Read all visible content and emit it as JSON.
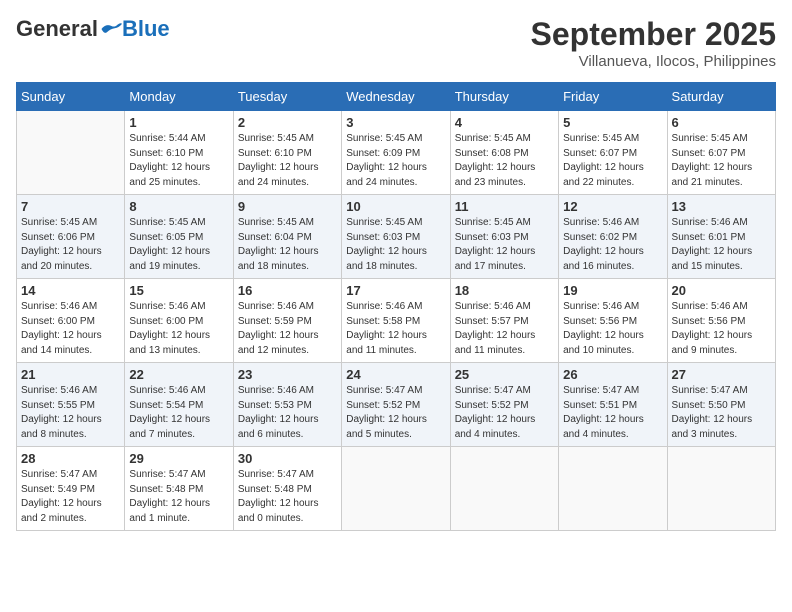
{
  "header": {
    "logo_general": "General",
    "logo_blue": "Blue",
    "month_title": "September 2025",
    "location": "Villanueva, Ilocos, Philippines"
  },
  "days_of_week": [
    "Sunday",
    "Monday",
    "Tuesday",
    "Wednesday",
    "Thursday",
    "Friday",
    "Saturday"
  ],
  "weeks": [
    [
      {
        "day": "",
        "info": ""
      },
      {
        "day": "1",
        "info": "Sunrise: 5:44 AM\nSunset: 6:10 PM\nDaylight: 12 hours\nand 25 minutes."
      },
      {
        "day": "2",
        "info": "Sunrise: 5:45 AM\nSunset: 6:10 PM\nDaylight: 12 hours\nand 24 minutes."
      },
      {
        "day": "3",
        "info": "Sunrise: 5:45 AM\nSunset: 6:09 PM\nDaylight: 12 hours\nand 24 minutes."
      },
      {
        "day": "4",
        "info": "Sunrise: 5:45 AM\nSunset: 6:08 PM\nDaylight: 12 hours\nand 23 minutes."
      },
      {
        "day": "5",
        "info": "Sunrise: 5:45 AM\nSunset: 6:07 PM\nDaylight: 12 hours\nand 22 minutes."
      },
      {
        "day": "6",
        "info": "Sunrise: 5:45 AM\nSunset: 6:07 PM\nDaylight: 12 hours\nand 21 minutes."
      }
    ],
    [
      {
        "day": "7",
        "info": "Sunrise: 5:45 AM\nSunset: 6:06 PM\nDaylight: 12 hours\nand 20 minutes."
      },
      {
        "day": "8",
        "info": "Sunrise: 5:45 AM\nSunset: 6:05 PM\nDaylight: 12 hours\nand 19 minutes."
      },
      {
        "day": "9",
        "info": "Sunrise: 5:45 AM\nSunset: 6:04 PM\nDaylight: 12 hours\nand 18 minutes."
      },
      {
        "day": "10",
        "info": "Sunrise: 5:45 AM\nSunset: 6:03 PM\nDaylight: 12 hours\nand 18 minutes."
      },
      {
        "day": "11",
        "info": "Sunrise: 5:45 AM\nSunset: 6:03 PM\nDaylight: 12 hours\nand 17 minutes."
      },
      {
        "day": "12",
        "info": "Sunrise: 5:46 AM\nSunset: 6:02 PM\nDaylight: 12 hours\nand 16 minutes."
      },
      {
        "day": "13",
        "info": "Sunrise: 5:46 AM\nSunset: 6:01 PM\nDaylight: 12 hours\nand 15 minutes."
      }
    ],
    [
      {
        "day": "14",
        "info": "Sunrise: 5:46 AM\nSunset: 6:00 PM\nDaylight: 12 hours\nand 14 minutes."
      },
      {
        "day": "15",
        "info": "Sunrise: 5:46 AM\nSunset: 6:00 PM\nDaylight: 12 hours\nand 13 minutes."
      },
      {
        "day": "16",
        "info": "Sunrise: 5:46 AM\nSunset: 5:59 PM\nDaylight: 12 hours\nand 12 minutes."
      },
      {
        "day": "17",
        "info": "Sunrise: 5:46 AM\nSunset: 5:58 PM\nDaylight: 12 hours\nand 11 minutes."
      },
      {
        "day": "18",
        "info": "Sunrise: 5:46 AM\nSunset: 5:57 PM\nDaylight: 12 hours\nand 11 minutes."
      },
      {
        "day": "19",
        "info": "Sunrise: 5:46 AM\nSunset: 5:56 PM\nDaylight: 12 hours\nand 10 minutes."
      },
      {
        "day": "20",
        "info": "Sunrise: 5:46 AM\nSunset: 5:56 PM\nDaylight: 12 hours\nand 9 minutes."
      }
    ],
    [
      {
        "day": "21",
        "info": "Sunrise: 5:46 AM\nSunset: 5:55 PM\nDaylight: 12 hours\nand 8 minutes."
      },
      {
        "day": "22",
        "info": "Sunrise: 5:46 AM\nSunset: 5:54 PM\nDaylight: 12 hours\nand 7 minutes."
      },
      {
        "day": "23",
        "info": "Sunrise: 5:46 AM\nSunset: 5:53 PM\nDaylight: 12 hours\nand 6 minutes."
      },
      {
        "day": "24",
        "info": "Sunrise: 5:47 AM\nSunset: 5:52 PM\nDaylight: 12 hours\nand 5 minutes."
      },
      {
        "day": "25",
        "info": "Sunrise: 5:47 AM\nSunset: 5:52 PM\nDaylight: 12 hours\nand 4 minutes."
      },
      {
        "day": "26",
        "info": "Sunrise: 5:47 AM\nSunset: 5:51 PM\nDaylight: 12 hours\nand 4 minutes."
      },
      {
        "day": "27",
        "info": "Sunrise: 5:47 AM\nSunset: 5:50 PM\nDaylight: 12 hours\nand 3 minutes."
      }
    ],
    [
      {
        "day": "28",
        "info": "Sunrise: 5:47 AM\nSunset: 5:49 PM\nDaylight: 12 hours\nand 2 minutes."
      },
      {
        "day": "29",
        "info": "Sunrise: 5:47 AM\nSunset: 5:48 PM\nDaylight: 12 hours\nand 1 minute."
      },
      {
        "day": "30",
        "info": "Sunrise: 5:47 AM\nSunset: 5:48 PM\nDaylight: 12 hours\nand 0 minutes."
      },
      {
        "day": "",
        "info": ""
      },
      {
        "day": "",
        "info": ""
      },
      {
        "day": "",
        "info": ""
      },
      {
        "day": "",
        "info": ""
      }
    ]
  ]
}
